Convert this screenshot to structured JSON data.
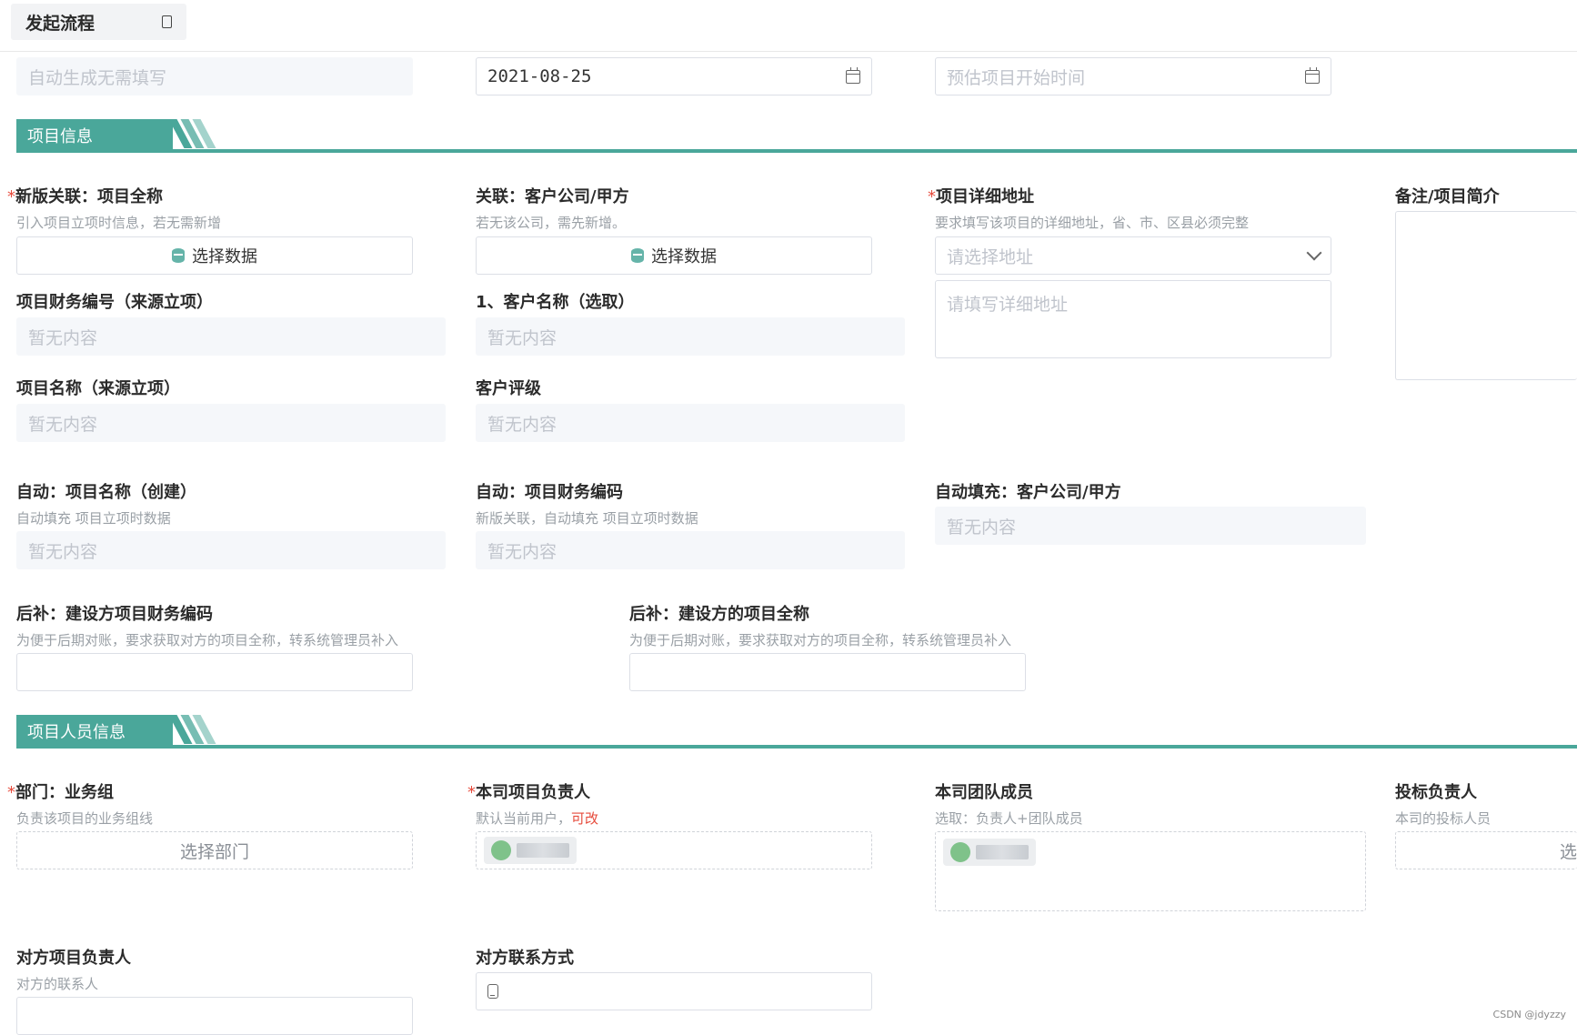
{
  "tab": {
    "label": "发起流程"
  },
  "top_row": {
    "auto_field_placeholder": "自动生成无需填写",
    "date_value": "2021-08-25",
    "start_time_placeholder": "预估项目开始时间"
  },
  "sections": {
    "project_info": "项目信息",
    "project_people": "项目人员信息"
  },
  "fields": {
    "project_fullname": {
      "label": "新版关联：项目全称",
      "hint": "引入项目立项时信息，若无需新增",
      "button": "选择数据"
    },
    "client_company": {
      "label": "关联：客户公司/甲方",
      "hint": "若无该公司，需先新增。",
      "button": "选择数据"
    },
    "address": {
      "label": "项目详细地址",
      "hint": "要求填写该项目的详细地址，省、市、区县必须完整",
      "select_placeholder": "请选择地址",
      "detail_placeholder": "请填写详细地址"
    },
    "remark": {
      "label": "备注/项目简介"
    },
    "finance_no": {
      "label": "项目财务编号（来源立项）",
      "value": "暂无内容"
    },
    "client_name": {
      "label": "1、客户名称（选取）",
      "value": "暂无内容"
    },
    "project_name_src": {
      "label": "项目名称（来源立项）",
      "value": "暂无内容"
    },
    "client_rating": {
      "label": "客户评级",
      "value": "暂无内容"
    },
    "auto_project_name": {
      "label": "自动：项目名称（创建）",
      "hint": "自动填充 项目立项时数据",
      "value": "暂无内容"
    },
    "auto_finance_code": {
      "label": "自动：项目财务编码",
      "hint": "新版关联，自动填充 项目立项时数据",
      "value": "暂无内容"
    },
    "auto_client": {
      "label": "自动填充：客户公司/甲方",
      "value": "暂无内容"
    },
    "builder_finance_code": {
      "label": "后补：建设方项目财务编码",
      "hint": "为便于后期对账，要求获取对方的项目全称，转系统管理员补入"
    },
    "builder_fullname": {
      "label": "后补：建设方的项目全称",
      "hint": "为便于后期对账，要求获取对方的项目全称，转系统管理员补入"
    },
    "department": {
      "label": "部门：业务组",
      "hint": "负责该项目的业务组线",
      "button": "选择部门"
    },
    "project_lead": {
      "label": "本司项目负责人",
      "hint_prefix": "默认当前用户，",
      "hint_red": "可改"
    },
    "team_members": {
      "label": "本司团队成员",
      "hint": "选取：负责人+团队成员"
    },
    "bid_lead": {
      "label": "投标负责人",
      "hint": "本司的投标人员",
      "button_partial": "选"
    },
    "counterpart_lead": {
      "label": "对方项目负责人",
      "hint": "对方的联系人"
    },
    "counterpart_contact": {
      "label": "对方联系方式"
    }
  },
  "watermark": "CSDN @jdyzzy",
  "colors": {
    "accent": "#4aa79a",
    "required": "#e64b3c"
  }
}
